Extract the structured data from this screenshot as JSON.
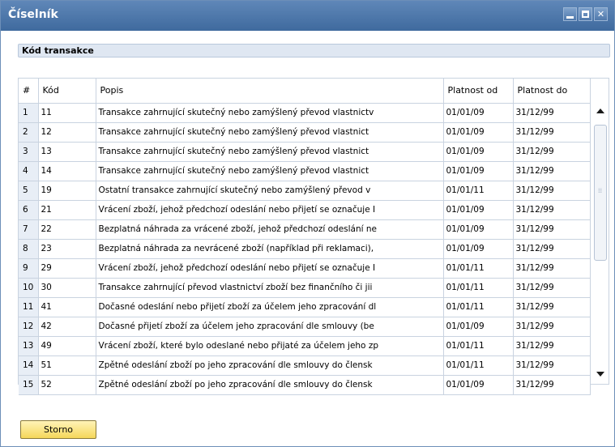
{
  "window": {
    "title": "Číselník",
    "section_header": "Kód transakce",
    "min_icon": "minimize-icon",
    "max_icon": "maximize-icon",
    "close_icon": "close-icon"
  },
  "table": {
    "columns": [
      "#",
      "Kód",
      "Popis",
      "Platnost od",
      "Platnost do"
    ],
    "rows": [
      {
        "n": "1",
        "kod": "11",
        "popis": "Transakce zahrnující skutečný nebo zamýšlený převod vlastnictv",
        "od": "01/01/09",
        "do": "31/12/99"
      },
      {
        "n": "2",
        "kod": "12",
        "popis": "Transakce zahrnující skutečný nebo zamýšlený převod vlastnict",
        "od": "01/01/09",
        "do": "31/12/99"
      },
      {
        "n": "3",
        "kod": "13",
        "popis": "Transakce zahrnující skutečný nebo zamýšlený převod vlastnict",
        "od": "01/01/09",
        "do": "31/12/99"
      },
      {
        "n": "4",
        "kod": "14",
        "popis": "Transakce zahrnující skutečný nebo zamýšlený převod vlastnict",
        "od": "01/01/09",
        "do": "31/12/99"
      },
      {
        "n": "5",
        "kod": "19",
        "popis": "Ostatní transakce zahrnující skutečný nebo zamýšlený převod v",
        "od": "01/01/11",
        "do": "31/12/99"
      },
      {
        "n": "6",
        "kod": "21",
        "popis": "Vrácení zboží, jehož předchozí odeslání nebo přijetí se označuje I",
        "od": "01/01/09",
        "do": "31/12/99"
      },
      {
        "n": "7",
        "kod": "22",
        "popis": "Bezplatná náhrada za vrácené zboží, jehož předchozí odeslání ne",
        "od": "01/01/09",
        "do": "31/12/99"
      },
      {
        "n": "8",
        "kod": "23",
        "popis": "Bezplatná náhrada za nevrácené zboží (například při reklamaci),",
        "od": "01/01/09",
        "do": "31/12/99"
      },
      {
        "n": "9",
        "kod": "29",
        "popis": "Vrácení zboží, jehož předchozí odeslání nebo přijetí se označuje I",
        "od": "01/01/11",
        "do": "31/12/99"
      },
      {
        "n": "10",
        "kod": "30",
        "popis": "Transakce zahrnující převod vlastnictví zboží bez finančního či jii",
        "od": "01/01/11",
        "do": "31/12/99"
      },
      {
        "n": "11",
        "kod": "41",
        "popis": "Dočasné odeslání nebo přijetí zboží za účelem jeho zpracování dl",
        "od": "01/01/11",
        "do": "31/12/99"
      },
      {
        "n": "12",
        "kod": "42",
        "popis": "Dočasné přijetí zboží za účelem jeho zpracování dle smlouvy (be",
        "od": "01/01/09",
        "do": "31/12/99"
      },
      {
        "n": "13",
        "kod": "49",
        "popis": "Vrácení zboží, které bylo odeslané nebo přijaté za účelem jeho zp",
        "od": "01/01/11",
        "do": "31/12/99"
      },
      {
        "n": "14",
        "kod": "51",
        "popis": "Zpětné odeslání zboží po jeho zpracování dle smlouvy do člensk",
        "od": "01/01/11",
        "do": "31/12/99"
      },
      {
        "n": "15",
        "kod": "52",
        "popis": "Zpětné odeslání zboží po jeho zpracování dle smlouvy do člensk",
        "od": "01/01/09",
        "do": "31/12/99"
      }
    ]
  },
  "footer": {
    "storno_label": "Storno"
  }
}
